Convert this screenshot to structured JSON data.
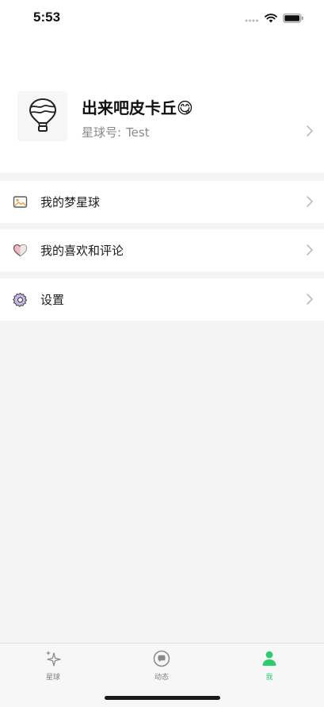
{
  "status_bar": {
    "time": "5:53",
    "icons": [
      "signal-icon",
      "wifi-icon",
      "battery-icon"
    ]
  },
  "profile": {
    "name": "出来吧皮卡丘😋",
    "id_label": "星球号:",
    "id_value": "Test",
    "avatar_icon": "hot-air-balloon-icon"
  },
  "menu": {
    "items": [
      {
        "label": "我的梦星球",
        "icon": "image-icon"
      },
      {
        "label": "我的喜欢和评论",
        "icon": "heart-icon"
      },
      {
        "label": "设置",
        "icon": "gear-icon"
      }
    ]
  },
  "tab_bar": {
    "tabs": [
      {
        "label": "星球",
        "icon": "sparkle-icon",
        "active": false
      },
      {
        "label": "动态",
        "icon": "chat-bubble-icon",
        "active": false
      },
      {
        "label": "我",
        "icon": "person-icon",
        "active": true
      }
    ]
  },
  "colors": {
    "accent": "#2ecc71",
    "background": "#f4f4f4",
    "card": "#ffffff",
    "muted_text": "#8a8a8a"
  }
}
